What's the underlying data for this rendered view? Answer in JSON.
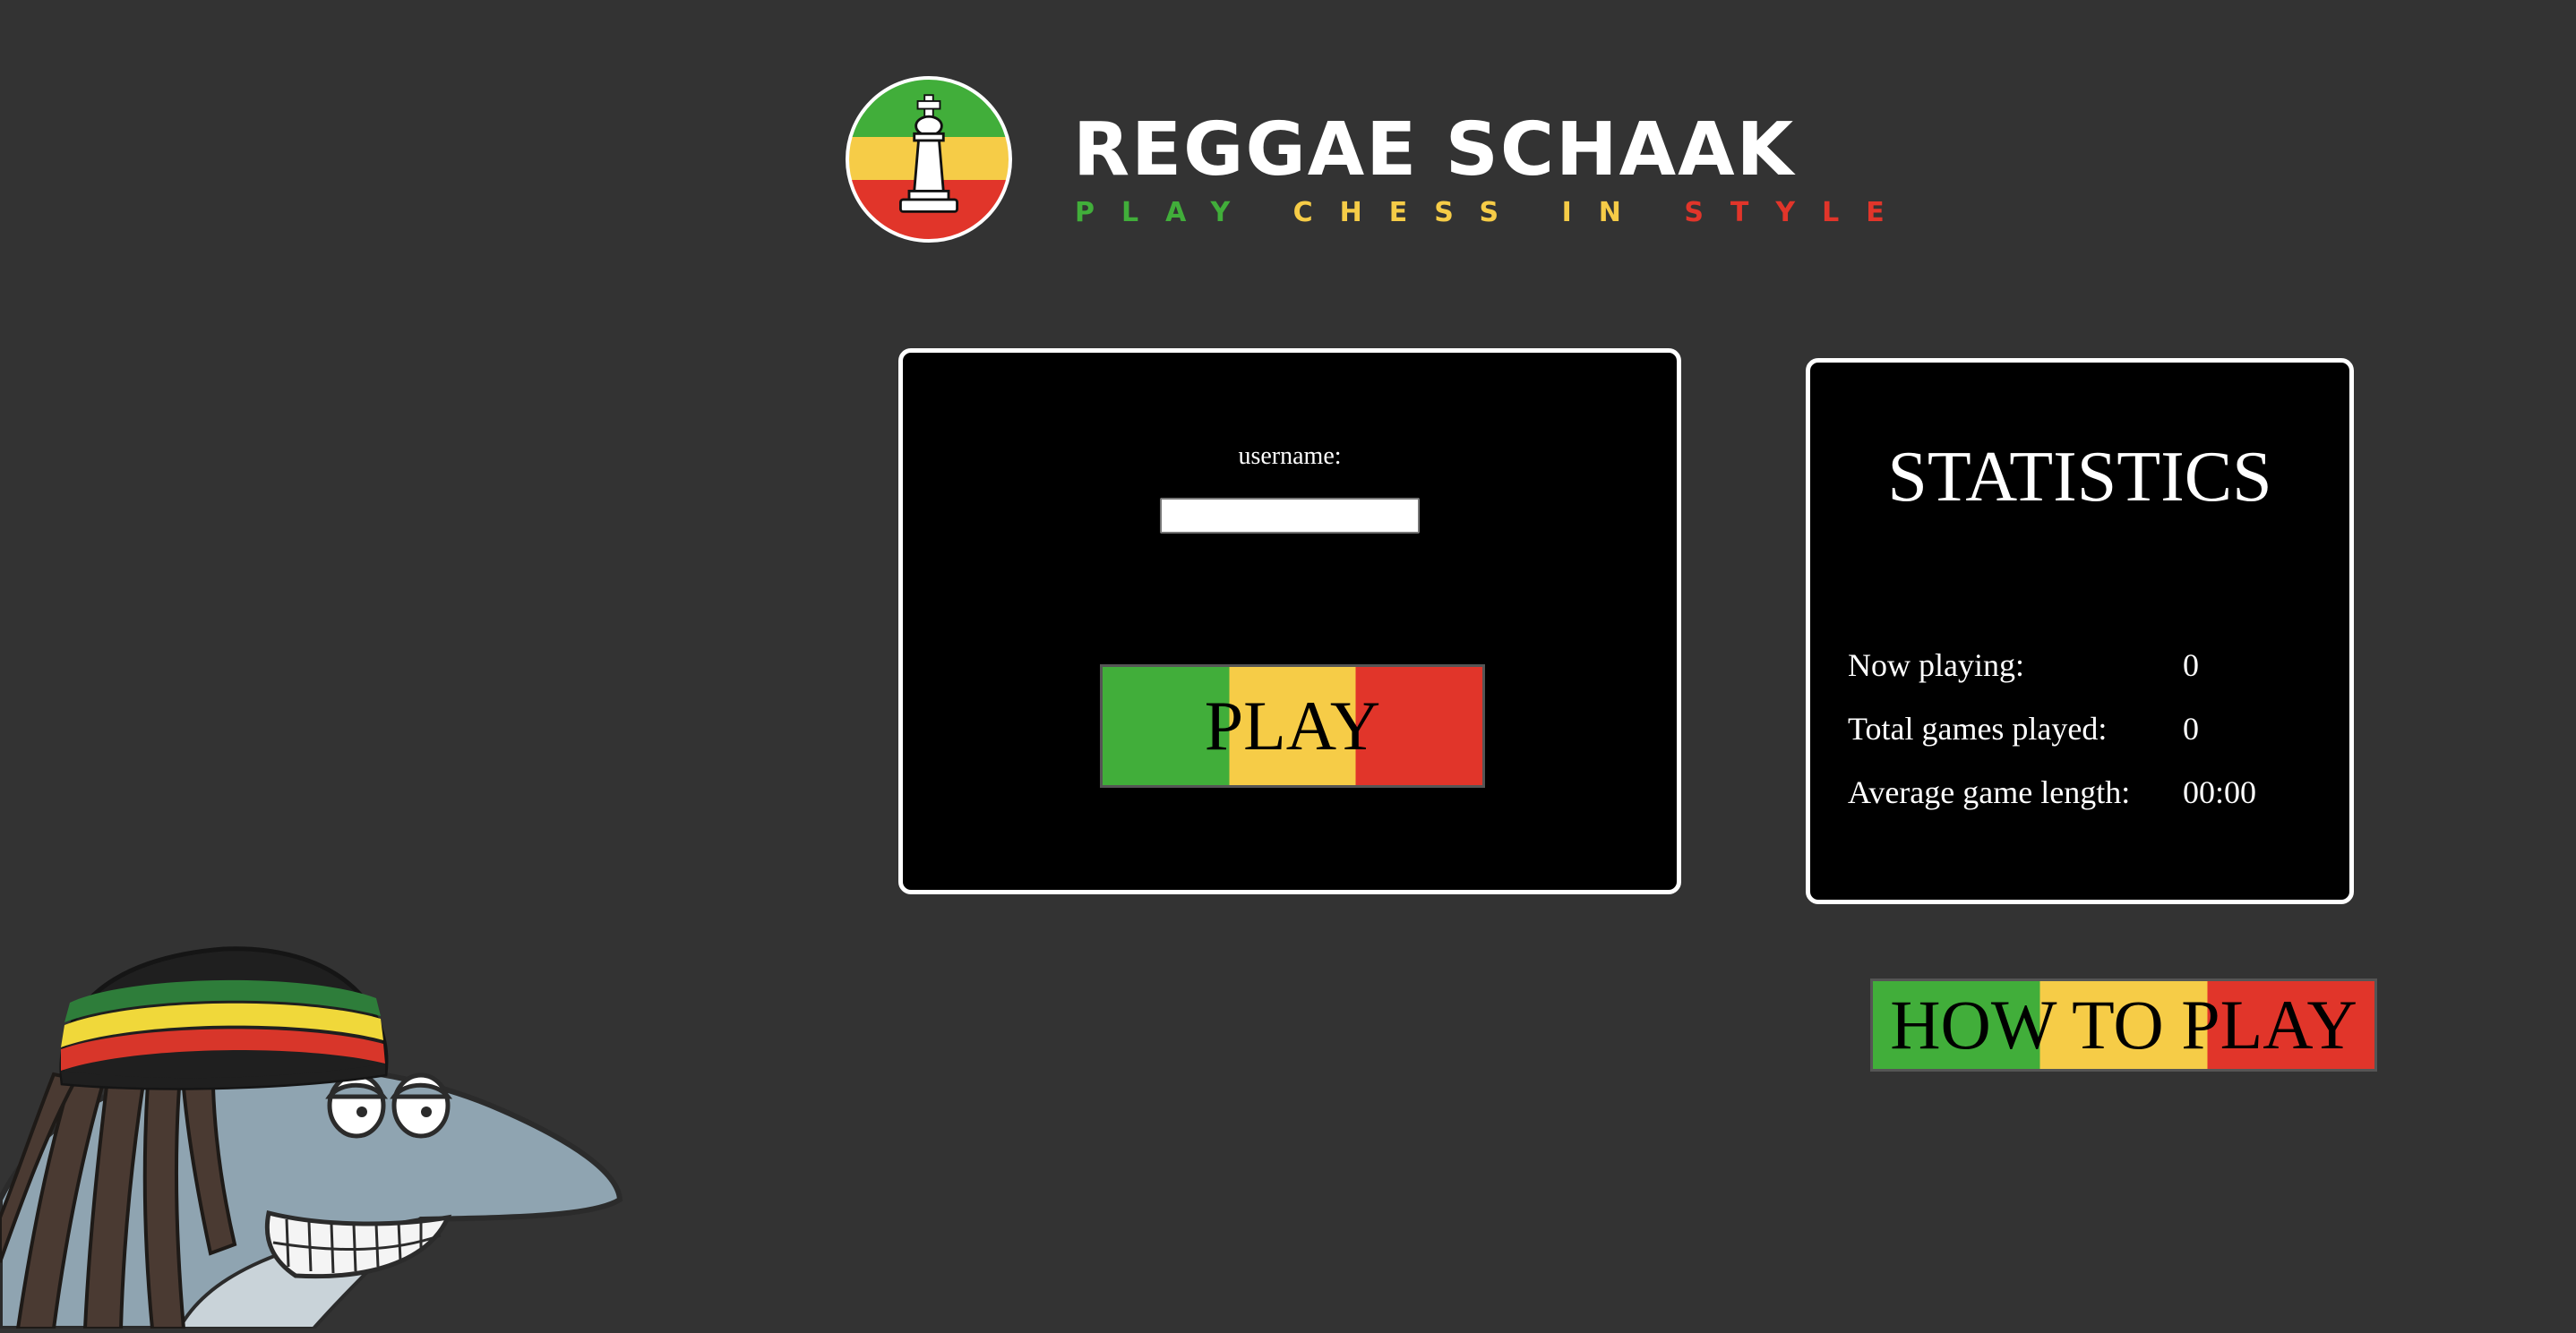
{
  "logo": {
    "title": "REGGAE SCHAAK",
    "tagline": {
      "play": "PLAY",
      "chess": "CHESS",
      "in": "IN",
      "style": "STYLE"
    },
    "icon": "chess-king-icon"
  },
  "login": {
    "username_label": "username:",
    "username_value": "",
    "play_label": "PLAY"
  },
  "statistics": {
    "title": "STATISTICS",
    "rows": [
      {
        "label": "Now playing:",
        "value": "0"
      },
      {
        "label": "Total games played:",
        "value": "0"
      },
      {
        "label": "Average game length:",
        "value": "00:00"
      }
    ]
  },
  "how_to_play": {
    "label": "HOW TO PLAY"
  },
  "colors": {
    "background": "#333333",
    "green": "#41ae3a",
    "yellow": "#f6cc47",
    "red": "#e1352a",
    "panel": "#000000"
  },
  "mascot": {
    "icon": "rasta-shark-mascot"
  }
}
